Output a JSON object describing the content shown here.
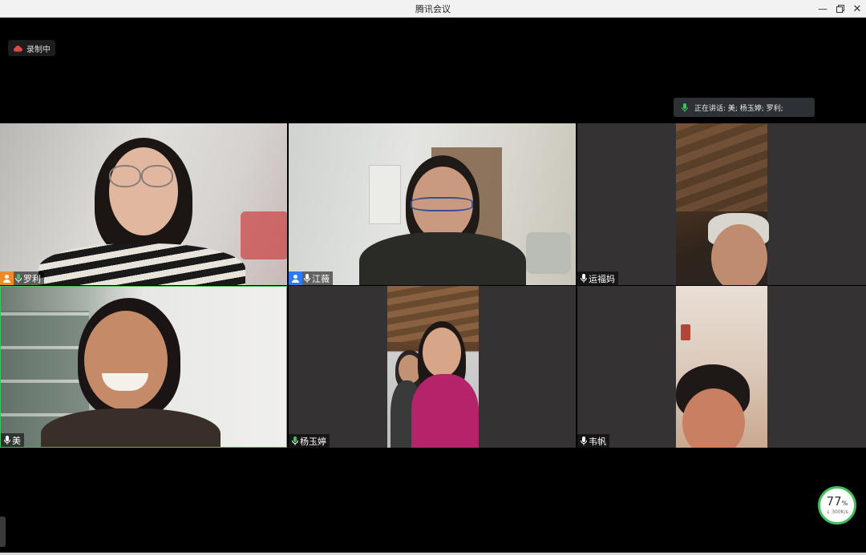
{
  "window": {
    "title": "腾讯会议"
  },
  "recording": {
    "label": "录制中",
    "icon": "cloud-icon"
  },
  "speaking": {
    "label": "正在讲话: 美; 杨玉婷; 罗利;",
    "icon": "mic-icon"
  },
  "participants": [
    {
      "name": "罗利",
      "host": true,
      "mic": "active"
    },
    {
      "name": "江薇",
      "host": true,
      "mic": "on"
    },
    {
      "name": "运福妈",
      "host": false,
      "mic": "on"
    },
    {
      "name": "美",
      "host": false,
      "mic": "on"
    },
    {
      "name": "杨玉婷",
      "host": false,
      "mic": "active"
    },
    {
      "name": "韦帆",
      "host": false,
      "mic": "on"
    }
  ],
  "network": {
    "percent": "77",
    "percent_sign": "%",
    "speed": "↓ 300K/s"
  },
  "colors": {
    "active_mic": "#3ec05a",
    "host_orange": "#f08a24",
    "host_blue": "#2d7cf6"
  }
}
